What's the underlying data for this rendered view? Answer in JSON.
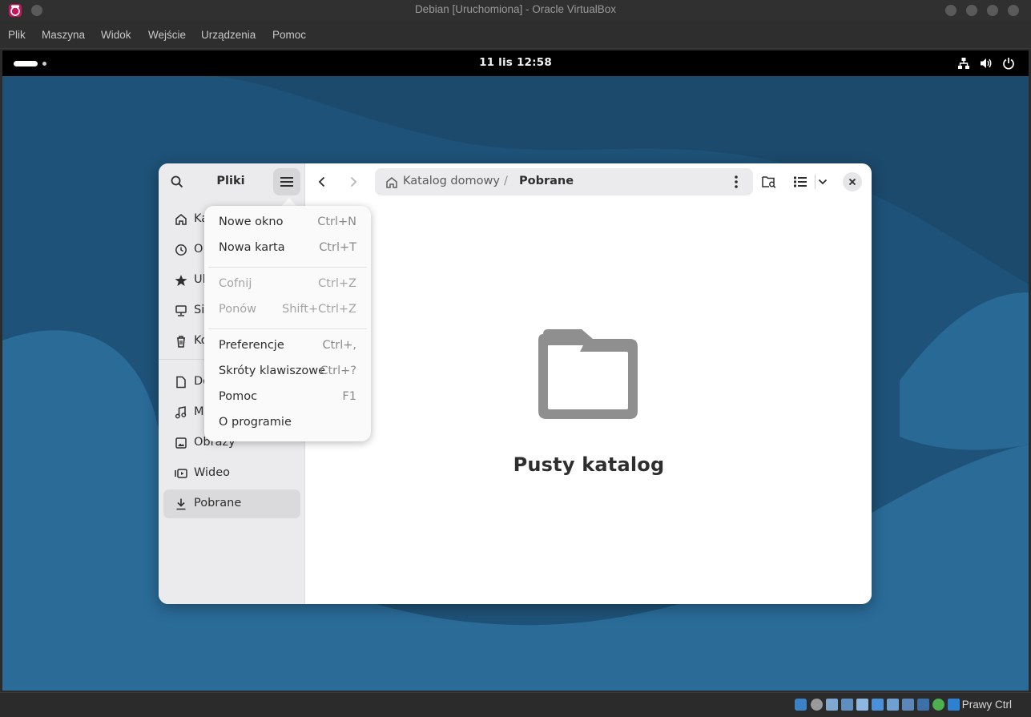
{
  "host_window": {
    "title": "Debian [Uruchomiona] - Oracle VirtualBox",
    "menu": [
      "Plik",
      "Maszyna",
      "Widok",
      "Wejście",
      "Urządzenia",
      "Pomoc"
    ],
    "status_host_key": "Prawy Ctrl"
  },
  "gnome_topbar": {
    "clock": "11 lis  12:58",
    "icons": [
      "network-icon",
      "volume-icon",
      "power-icon"
    ]
  },
  "files": {
    "app_title": "Pliki",
    "sidebar": {
      "places": [
        {
          "label": "Ka",
          "icon": "home-icon"
        },
        {
          "label": "O",
          "icon": "recent-icon"
        },
        {
          "label": "Ul",
          "icon": "star-icon"
        },
        {
          "label": "Si",
          "icon": "network-icon"
        },
        {
          "label": "Ko",
          "icon": "trash-icon"
        }
      ],
      "bookmarks": [
        {
          "label": "Do",
          "icon": "document-icon"
        },
        {
          "label": "M",
          "icon": "music-icon"
        },
        {
          "label": "Obrazy",
          "icon": "image-icon"
        },
        {
          "label": "Wideo",
          "icon": "video-icon"
        },
        {
          "label": "Pobrane",
          "icon": "download-icon",
          "active": true
        }
      ]
    },
    "pathbar": {
      "home": "Katalog domowy",
      "separator": "/",
      "current": "Pobrane"
    },
    "empty_state": {
      "title": "Pusty katalog",
      "icon": "folder-icon"
    },
    "main_menu": {
      "groups": [
        [
          {
            "label": "Nowe okno",
            "accel": "Ctrl+N",
            "enabled": true
          },
          {
            "label": "Nowa karta",
            "accel": "Ctrl+T",
            "enabled": true
          }
        ],
        [
          {
            "label": "Cofnij",
            "accel": "Ctrl+Z",
            "enabled": false
          },
          {
            "label": "Ponów",
            "accel": "Shift+Ctrl+Z",
            "enabled": false
          }
        ],
        [
          {
            "label": "Preferencje",
            "accel": "Ctrl+,",
            "enabled": true
          },
          {
            "label": "Skróty klawiszowe",
            "accel": "Ctrl+?",
            "enabled": true
          },
          {
            "label": "Pomoc",
            "accel": "F1",
            "enabled": true
          },
          {
            "label": "O programie",
            "accel": "",
            "enabled": true
          }
        ]
      ]
    }
  },
  "colors": {
    "wallpaper_dark": "#1d4f73",
    "wallpaper_light": "#2a6a96",
    "sidebar_bg": "#ebebed",
    "folder_gray": "#8f8f8f"
  }
}
